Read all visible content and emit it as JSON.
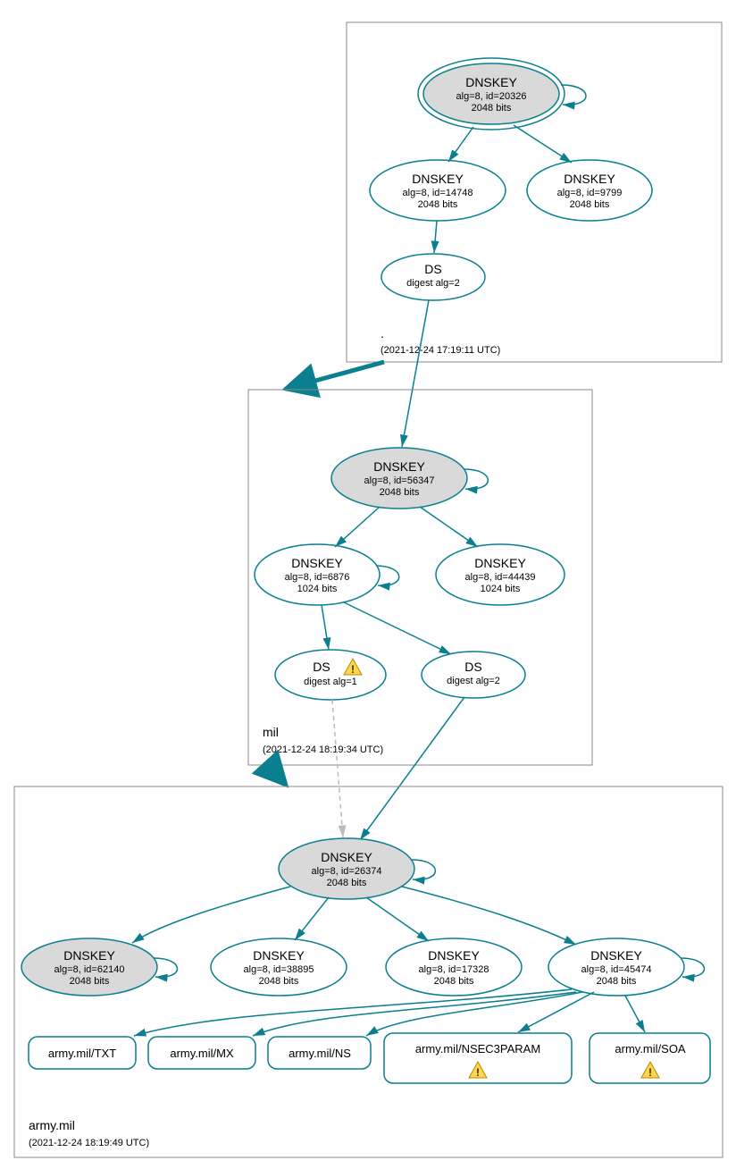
{
  "zones": {
    "root": {
      "label": ".",
      "timestamp": "(2021-12-24 17:19:11 UTC)",
      "ksk": {
        "title": "DNSKEY",
        "line2": "alg=8, id=20326",
        "line3": "2048 bits"
      },
      "zsk1": {
        "title": "DNSKEY",
        "line2": "alg=8, id=14748",
        "line3": "2048 bits"
      },
      "zsk2": {
        "title": "DNSKEY",
        "line2": "alg=8, id=9799",
        "line3": "2048 bits"
      },
      "ds": {
        "title": "DS",
        "line2": "digest alg=2"
      }
    },
    "mil": {
      "label": "mil",
      "timestamp": "(2021-12-24 18:19:34 UTC)",
      "ksk": {
        "title": "DNSKEY",
        "line2": "alg=8, id=56347",
        "line3": "2048 bits"
      },
      "zsk1": {
        "title": "DNSKEY",
        "line2": "alg=8, id=6876",
        "line3": "1024 bits"
      },
      "zsk2": {
        "title": "DNSKEY",
        "line2": "alg=8, id=44439",
        "line3": "1024 bits"
      },
      "ds1": {
        "title": "DS",
        "line2": "digest alg=1"
      },
      "ds2": {
        "title": "DS",
        "line2": "digest alg=2"
      }
    },
    "army": {
      "label": "army.mil",
      "timestamp": "(2021-12-24 18:19:49 UTC)",
      "ksk": {
        "title": "DNSKEY",
        "line2": "alg=8, id=26374",
        "line3": "2048 bits"
      },
      "k1": {
        "title": "DNSKEY",
        "line2": "alg=8, id=62140",
        "line3": "2048 bits"
      },
      "k2": {
        "title": "DNSKEY",
        "line2": "alg=8, id=38895",
        "line3": "2048 bits"
      },
      "k3": {
        "title": "DNSKEY",
        "line2": "alg=8, id=17328",
        "line3": "2048 bits"
      },
      "k4": {
        "title": "DNSKEY",
        "line2": "alg=8, id=45474",
        "line3": "2048 bits"
      },
      "rr_txt": "army.mil/TXT",
      "rr_mx": "army.mil/MX",
      "rr_ns": "army.mil/NS",
      "rr_nsec3": "army.mil/NSEC3PARAM",
      "rr_soa": "army.mil/SOA"
    }
  }
}
